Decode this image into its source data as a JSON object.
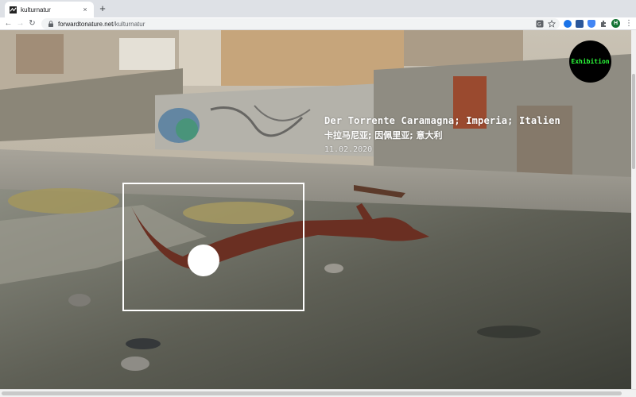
{
  "browser": {
    "tab": {
      "title": "kulturnatur",
      "close_glyph": "×"
    },
    "new_tab_glyph": "+",
    "nav": {
      "back_glyph": "←",
      "forward_glyph": "→",
      "reload_glyph": "↻"
    },
    "address": {
      "host": "forwardtonature.net",
      "path": "/kulturnatur"
    },
    "profile_initial": "H",
    "menu_glyph": "⋮",
    "icons": [
      "translate-icon",
      "star-icon",
      "extension-icons",
      "puzzle-icon",
      "profile-avatar",
      "menu-icon"
    ]
  },
  "page": {
    "caption": {
      "title": "Der Torrente Caramagna; Imperia; Italien",
      "subtitle": "卡拉马尼亚; 因佩里亚; 意大利",
      "date": "11.02.2020"
    },
    "exhibition_button": "Exhibition",
    "colors": {
      "exhibition_bg": "#000000",
      "exhibition_text": "#2bff3a",
      "frame": "#ffffff"
    }
  }
}
